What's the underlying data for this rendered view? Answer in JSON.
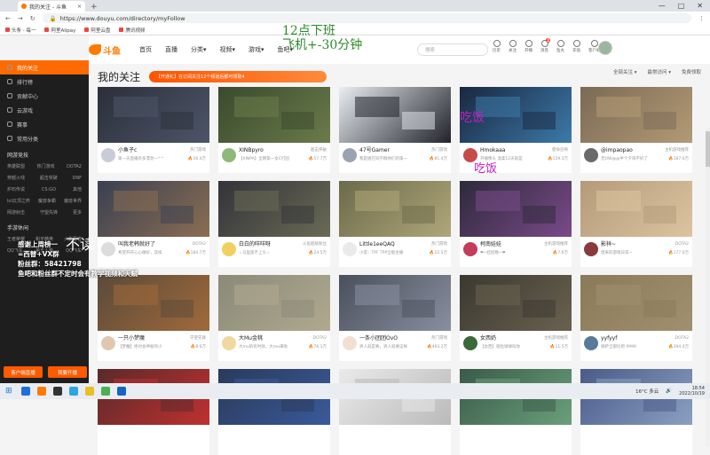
{
  "browser": {
    "tab_title": "我的关注 - 斗鱼",
    "new_tab": "+",
    "win_min": "—",
    "win_max": "□",
    "win_close": "✕",
    "nav_back": "←",
    "nav_fwd": "→",
    "nav_reload": "↻",
    "url": "https://www.douyu.com/directory/myFollow",
    "bookmarks": [
      "头条 - 每一",
      "阿里Alipay",
      "阿里云盘",
      "腾讯视频"
    ]
  },
  "header": {
    "logo_text": "斗鱼",
    "nav": [
      "首页",
      "直播",
      "分类▾",
      "视频▾",
      "游戏▾",
      "鱼吧▾"
    ],
    "search_placeholder": "搜索",
    "icons": [
      {
        "name": "history-icon",
        "label": "历史"
      },
      {
        "name": "follow-icon",
        "label": "关注"
      },
      {
        "name": "live-icon",
        "label": "开播"
      },
      {
        "name": "message-icon",
        "label": "消息",
        "badge": "2"
      },
      {
        "name": "task-icon",
        "label": "鱼丸"
      },
      {
        "name": "recharge-icon",
        "label": "充值"
      },
      {
        "name": "download-icon",
        "label": "客户端"
      }
    ]
  },
  "overlay_text": {
    "line1": "12点下班",
    "line2": "飞机+-30分钟",
    "chi1": "吃饭",
    "chi2": "吃饭",
    "mid_big": "不读",
    "mid_lines": [
      "感谢上周榜一",
      "=西替+VX群",
      "粉丝群：58421798",
      "鱼吧和粉丝群不定时会有教学视频和天赋"
    ]
  },
  "sidebar": {
    "items": [
      {
        "label": "我的关注",
        "icon": "heart-icon",
        "active": true
      },
      {
        "label": "排行榜",
        "icon": "rank-icon",
        "active": false
      },
      {
        "label": "贡献中心",
        "icon": "contrib-icon",
        "active": false
      },
      {
        "label": "云游戏",
        "icon": "cloud-game-icon",
        "active": false
      },
      {
        "label": "赛事",
        "icon": "event-icon",
        "active": false
      },
      {
        "label": "常用分类",
        "icon": "category-icon",
        "active": false
      }
    ],
    "section1": "网游竞技",
    "grid1": [
      [
        "英雄联盟",
        "热门游戏",
        "DOTA2"
      ],
      [
        "穿越火线",
        "超击突破",
        "DNF"
      ],
      [
        "炉石传说",
        "CS:GO",
        "其他"
      ],
      [
        "lol云顶之弈",
        "魔兽争霸",
        "魔兽世界"
      ],
      [
        "网游射击",
        "守望先锋",
        "更多"
      ]
    ],
    "section2": "手游休闲",
    "grid2": [
      [
        "王者荣耀",
        "和平精英",
        "火影忍者"
      ],
      [
        "QQ飞车",
        "第五人格",
        "QQ飞车"
      ]
    ],
    "btn_left": "客户端直播",
    "btn_right": "我要开播"
  },
  "page": {
    "title": "我的关注",
    "banner": "【开通礼】在订阅关注12个频道后都可领取4",
    "filters": [
      "全部关注 ▾",
      "最常访问 ▾",
      "免费领取"
    ]
  },
  "cards": [
    {
      "streamer": "小鱼子c",
      "category": "热门游戏",
      "title": "第一天直播有多漂亮~^^",
      "heat": "16.4万",
      "thumb": [
        "#2c2f3a",
        "#4c5568"
      ],
      "av": "#c9ccd6"
    },
    {
      "streamer": "XINBpyro",
      "category": "超击突破",
      "title": "【XINPA】全网第一女C打团",
      "heat": "57.7万",
      "thumb": [
        "#3a4a2e",
        "#6b7b4a"
      ],
      "av": "#8fb87a"
    },
    {
      "streamer": "47号Gamer",
      "category": "热门游戏",
      "title": "我是姐在同学群你们的第一",
      "heat": "81.4万",
      "thumb": [
        "#eaeef3",
        "#20242a"
      ],
      "av": "#9aa4b0"
    },
    {
      "streamer": "Hmokaaa",
      "category": "使命召唤",
      "title": "开播像头 温柔12天就是",
      "heat": "159.3万",
      "thumb": [
        "#1a2740",
        "#3c7aa8"
      ],
      "av": "#c84b4b"
    },
    {
      "streamer": "@impaopao",
      "category": "主机游戏推荐",
      "title": "无OW@@半个夕阳不好了",
      "heat": "187.0万",
      "thumb": [
        "#7a6a55",
        "#b49a75"
      ],
      "av": "#6a6a6a"
    },
    {
      "streamer": "叫我老韩就好了",
      "category": "DOTA2",
      "title": "希望开开心心做好，双排",
      "heat": "184.7万",
      "thumb": [
        "#3a3f52",
        "#8b6e52"
      ],
      "av": "#dcdcdc"
    },
    {
      "streamer": "白白的咩咩呀",
      "category": "斗鱼超级粉丝",
      "title": "☆马里奥不上头☆",
      "heat": "24.5万",
      "thumb": [
        "#33333a",
        "#6a6a55"
      ],
      "av": "#f0d060"
    },
    {
      "streamer": "Little1eeQAQ",
      "category": "热门游戏",
      "title": "小李：TPF TPP全能主播",
      "heat": "22.5万",
      "thumb": [
        "#6b6a4a",
        "#b0a77a"
      ],
      "av": "#eaeaea"
    },
    {
      "streamer": "柯南娃娃",
      "category": "主机游戏推荐",
      "title": "❤~娃娃晚~❤",
      "heat": "7.6万",
      "thumb": [
        "#2d2a3a",
        "#7a4a8a"
      ],
      "av": "#c43c5a"
    },
    {
      "streamer": "影祥~",
      "category": "DOTA2",
      "title": "借来的游戏日常~",
      "heat": "177.0万",
      "thumb": [
        "#b49a7a",
        "#dcc4a0"
      ],
      "av": "#8a3a3a"
    },
    {
      "streamer": "一只小梦魔",
      "category": "守望先锋",
      "title": "【梦魔】绝对会神秘的小",
      "heat": "8.6万",
      "thumb": [
        "#5a4a3a",
        "#a06a3a"
      ],
      "av": "#e0c8b0"
    },
    {
      "streamer": "大Mu金桃",
      "category": "DOTA2",
      "title": "大mu的有时效，大mu来啦",
      "heat": "76.1万",
      "thumb": [
        "#8a8a78",
        "#b0a990"
      ],
      "av": "#f0d8a0"
    },
    {
      "streamer": "一条小团团OvO",
      "category": "热门游戏",
      "title": "男人就是要，男人就要这样",
      "heat": "463.2万",
      "thumb": [
        "#4a4f5c",
        "#8a8fa0"
      ],
      "av": "#f0e0d0"
    },
    {
      "streamer": "女西奶",
      "category": "主机游戏推荐",
      "title": "【女西】值粒球球叫你",
      "heat": "11.5万",
      "thumb": [
        "#3a3830",
        "#6a6250"
      ],
      "av": "#3a6a3a"
    },
    {
      "streamer": "yyfyyf",
      "category": "DOTA2",
      "title": "德萨全部比吧 9999",
      "heat": "394.4万",
      "thumb": [
        "#8a7a5a",
        "#a09070"
      ],
      "av": "#5a7a9a"
    },
    {
      "streamer": "",
      "category": "",
      "title": "",
      "heat": "",
      "thumb": [
        "#5a2a2a",
        "#c03030"
      ],
      "av": "#fff"
    },
    {
      "streamer": "",
      "category": "",
      "title": "",
      "heat": "",
      "thumb": [
        "#2a3a5a",
        "#3a5a9a"
      ],
      "av": "#fff"
    },
    {
      "streamer": "",
      "category": "",
      "title": "",
      "heat": "",
      "thumb": [
        "#eaeaea",
        "#bababa"
      ],
      "av": "#fff"
    },
    {
      "streamer": "",
      "category": "",
      "title": "",
      "heat": "",
      "thumb": [
        "#3a5a4a",
        "#6aa07a"
      ],
      "av": "#fff"
    },
    {
      "streamer": "",
      "category": "",
      "title": "",
      "heat": "",
      "thumb": [
        "#4a5a8a",
        "#8aa0c0"
      ],
      "av": "#fff"
    }
  ],
  "taskbar": {
    "weather": "16°C 多云",
    "time": "18:54",
    "date": "2022/10/19",
    "apps": [
      "#1e6fd9",
      "#ff7a00",
      "#333",
      "#2ca5e0",
      "#e8c020",
      "#4caf50",
      "#1565c0"
    ]
  }
}
